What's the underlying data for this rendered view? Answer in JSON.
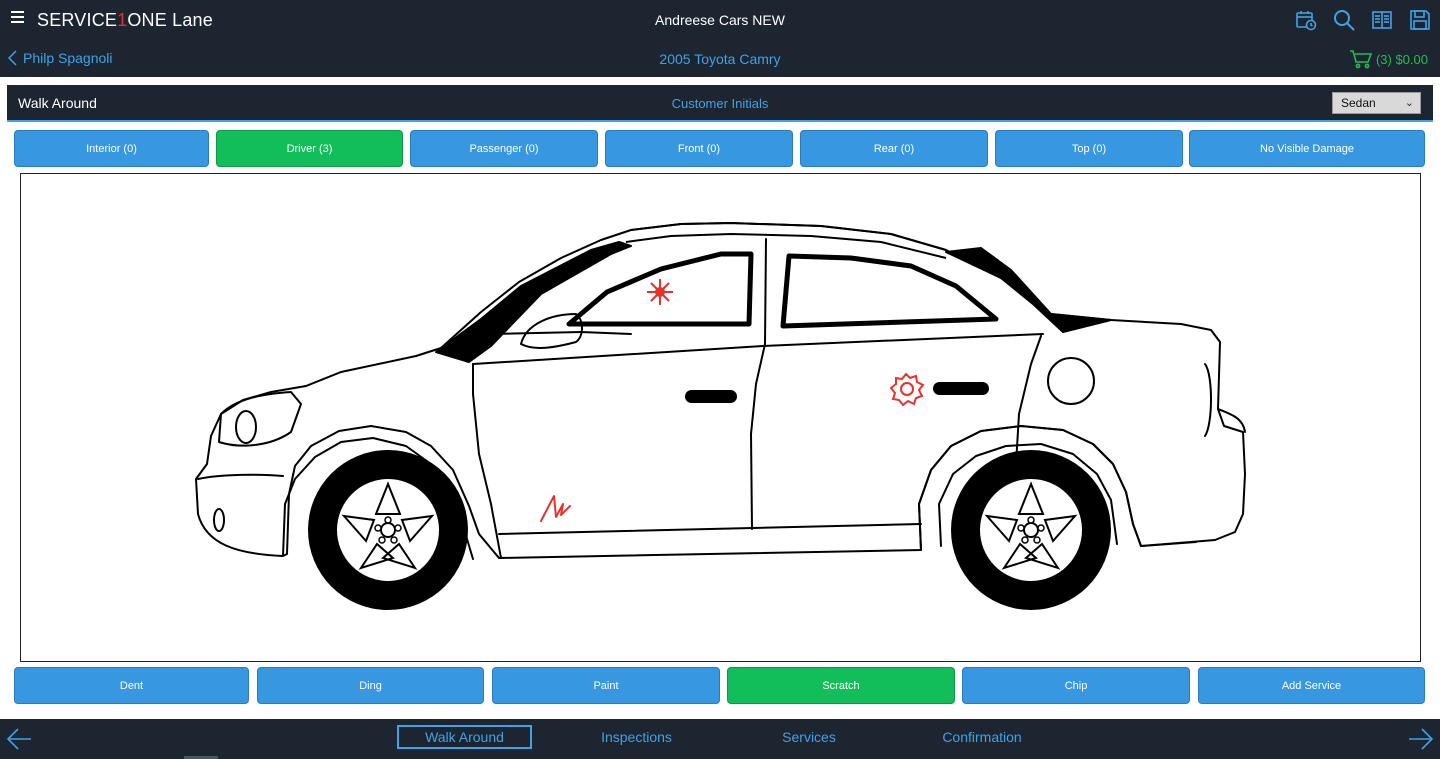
{
  "header": {
    "brand_prefix": "SERVICE",
    "brand_one": "1",
    "brand_suffix": "ONE Lane",
    "dealer": "Andreese Cars  NEW",
    "icons": [
      "calendar-icon",
      "search-icon",
      "book-icon",
      "save-icon"
    ]
  },
  "subheader": {
    "customer": "Philp Spagnoli",
    "vehicle": "2005 Toyota Camry",
    "cart": "(3) $0.00"
  },
  "panel": {
    "title": "Walk Around",
    "initials": "Customer Initials",
    "body_type": "Sedan"
  },
  "areas": [
    {
      "label": "Interior (0)",
      "active": false
    },
    {
      "label": "Driver (3)",
      "active": true
    },
    {
      "label": "Passenger (0)",
      "active": false
    },
    {
      "label": "Front (0)",
      "active": false
    },
    {
      "label": "Rear (0)",
      "active": false
    },
    {
      "label": "Top (0)",
      "active": false
    },
    {
      "label": "No Visible Damage",
      "active": false
    }
  ],
  "damage_types": [
    {
      "label": "Dent",
      "active": false
    },
    {
      "label": "Ding",
      "active": false
    },
    {
      "label": "Paint",
      "active": false
    },
    {
      "label": "Scratch",
      "active": true
    },
    {
      "label": "Chip",
      "active": false
    },
    {
      "label": "Add Service",
      "active": false
    }
  ],
  "markers": [
    {
      "type": "chip",
      "color": "#e5322d"
    },
    {
      "type": "ding",
      "color": "#e5322d"
    },
    {
      "type": "scratch",
      "color": "#e5322d"
    }
  ],
  "footer": {
    "steps": [
      "Walk Around",
      "Inspections",
      "Services",
      "Confirmation"
    ],
    "current": "Walk Around"
  },
  "colors": {
    "header_bg": "#1c2530",
    "accent": "#3ea3e9",
    "button_blue": "#3797e0",
    "button_green": "#12be5a",
    "cart_green": "#1fbf4f",
    "marker_red": "#e5322d"
  }
}
